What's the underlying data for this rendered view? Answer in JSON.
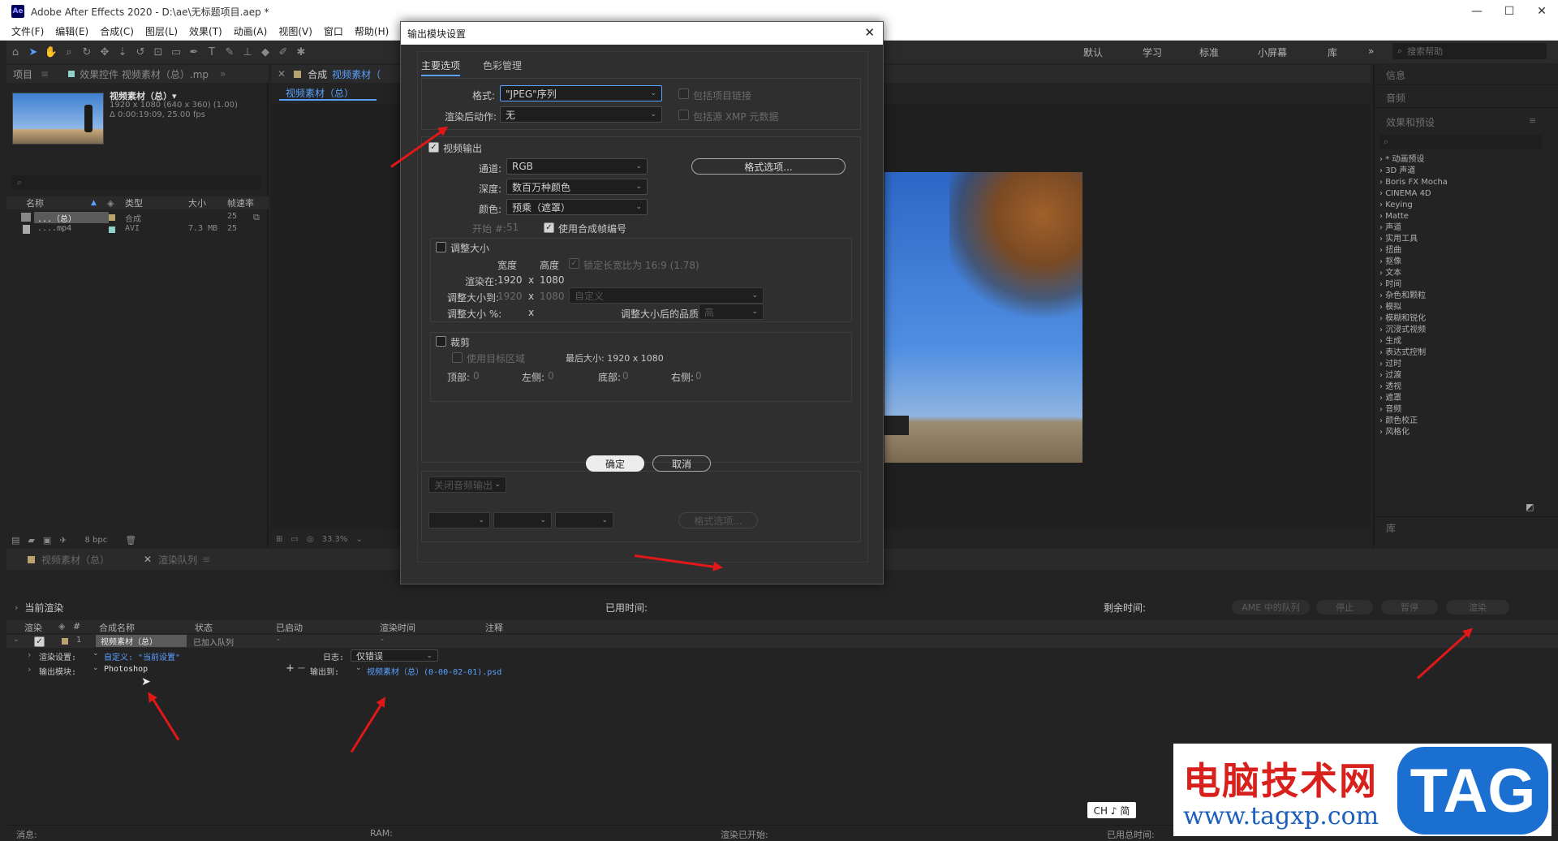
{
  "window": {
    "logo": "Ae",
    "title": "Adobe After Effects 2020 - D:\\ae\\无标题项目.aep *"
  },
  "menu": [
    "文件(F)",
    "编辑(E)",
    "合成(C)",
    "图层(L)",
    "效果(T)",
    "动画(A)",
    "视图(V)",
    "窗口",
    "帮助(H)"
  ],
  "workspaces": [
    "默认",
    "学习",
    "标准",
    "小屏幕",
    "库"
  ],
  "search_help": "搜索帮助",
  "project": {
    "tab1": "项目",
    "tab2": "效果控件 视频素材（总）.mp",
    "item_name": "视频素材（总）▾",
    "item_info1": "1920 x 1080  (640 x 360) (1.00)",
    "item_info2": "Δ 0:00:19:09, 25.00 fps",
    "columns": [
      "名称",
      "类型",
      "大小",
      "帧速率"
    ],
    "rows": [
      {
        "name": "...（总）",
        "type": "合成",
        "size": "",
        "fps": "25"
      },
      {
        "name": "....mp4",
        "type": "AVI",
        "size": "7.3 MB",
        "fps": "25"
      }
    ],
    "bpc": "8 bpc"
  },
  "comp": {
    "tab": "合成",
    "tab_name": "视频素材（",
    "crumb": "视频素材（总）",
    "zoom": "33.3%"
  },
  "right_panel": {
    "info": "信息",
    "audio": "音频",
    "effects_title": "效果和预设",
    "effects": [
      "* 动画预设",
      "3D 声道",
      "Boris FX Mocha",
      "CINEMA 4D",
      "Keying",
      "Matte",
      "声道",
      "实用工具",
      "扭曲",
      "抠像",
      "文本",
      "时间",
      "杂色和颗粒",
      "模拟",
      "模糊和锐化",
      "沉浸式视频",
      "生成",
      "表达式控制",
      "过时",
      "过渡",
      "透视",
      "遮罩",
      "音频",
      "颜色校正",
      "风格化"
    ],
    "library": "库"
  },
  "bottom": {
    "tab1": "视频素材（总）",
    "tab2": "渲染队列",
    "current_render": "当前渲染",
    "elapsed": "已用时间:",
    "remaining": "剩余时间:",
    "buttons": [
      "AME 中的队列",
      "停止",
      "暂停",
      "渲染"
    ],
    "columns": [
      "渲染",
      "#",
      "合成名称",
      "状态",
      "已启动",
      "渲染时间",
      "注释"
    ],
    "row": {
      "num": "1",
      "name": "视频素材（总）",
      "status": "已加入队列",
      "started": "-",
      "time": "-"
    },
    "render_settings_label": "渲染设置:",
    "render_settings_value": "自定义: \"当前设置\"",
    "log_label": "日志:",
    "log_value": "仅错误",
    "output_module_label": "输出模块:",
    "output_module_value": "Photoshop",
    "output_to_label": "输出到:",
    "output_to_value": "视频素材（总）(0-00-02-01).psd",
    "status": {
      "msg": "消息:",
      "ram": "RAM:",
      "start": "渲染已开始:",
      "total": "已用总时间:"
    },
    "ime": "CH ♪ 简"
  },
  "dialog": {
    "title": "输出模块设置",
    "tabs": [
      "主要选项",
      "色彩管理"
    ],
    "format_label": "格式:",
    "format_value": "\"JPEG\"序列",
    "include_link": "包括项目链接",
    "post_render_label": "渲染后动作:",
    "post_render_value": "无",
    "include_xmp": "包括源 XMP 元数据",
    "video_output": "视频输出",
    "channels_label": "通道:",
    "channels_value": "RGB",
    "format_options": "格式选项...",
    "depth_label": "深度:",
    "depth_value": "数百万种颜色",
    "color_label": "颜色:",
    "color_value": "预乘（遮罩）",
    "start_label": "开始 #:",
    "start_value": "51",
    "use_comp_frame": "使用合成帧编号",
    "resize": "调整大小",
    "width": "宽度",
    "height": "高度",
    "lock_ratio": "锁定长宽比为 16:9 (1.78)",
    "render_at_label": "渲染在:",
    "render_w": "1920",
    "render_h": "1080",
    "resize_to_label": "调整大小到:",
    "resize_w": "1920",
    "resize_h": "1080",
    "resize_preset": "自定义",
    "resize_pct_label": "调整大小 %:",
    "resize_quality_label": "调整大小后的品质:",
    "resize_quality": "高",
    "x": "x",
    "crop": "裁剪",
    "use_roi": "使用目标区域",
    "final_size": "最后大小: 1920 x 1080",
    "top_label": "顶部:",
    "left_label": "左侧:",
    "bottom_label": "底部:",
    "right_label": "右侧:",
    "zero": "0",
    "audio_output": "关闭音频输出",
    "format_options2": "格式选项...",
    "ok": "确定",
    "cancel": "取消"
  },
  "watermark": {
    "text": "电脑技术网",
    "url": "www.tagxp.com",
    "tag": "TAG"
  }
}
